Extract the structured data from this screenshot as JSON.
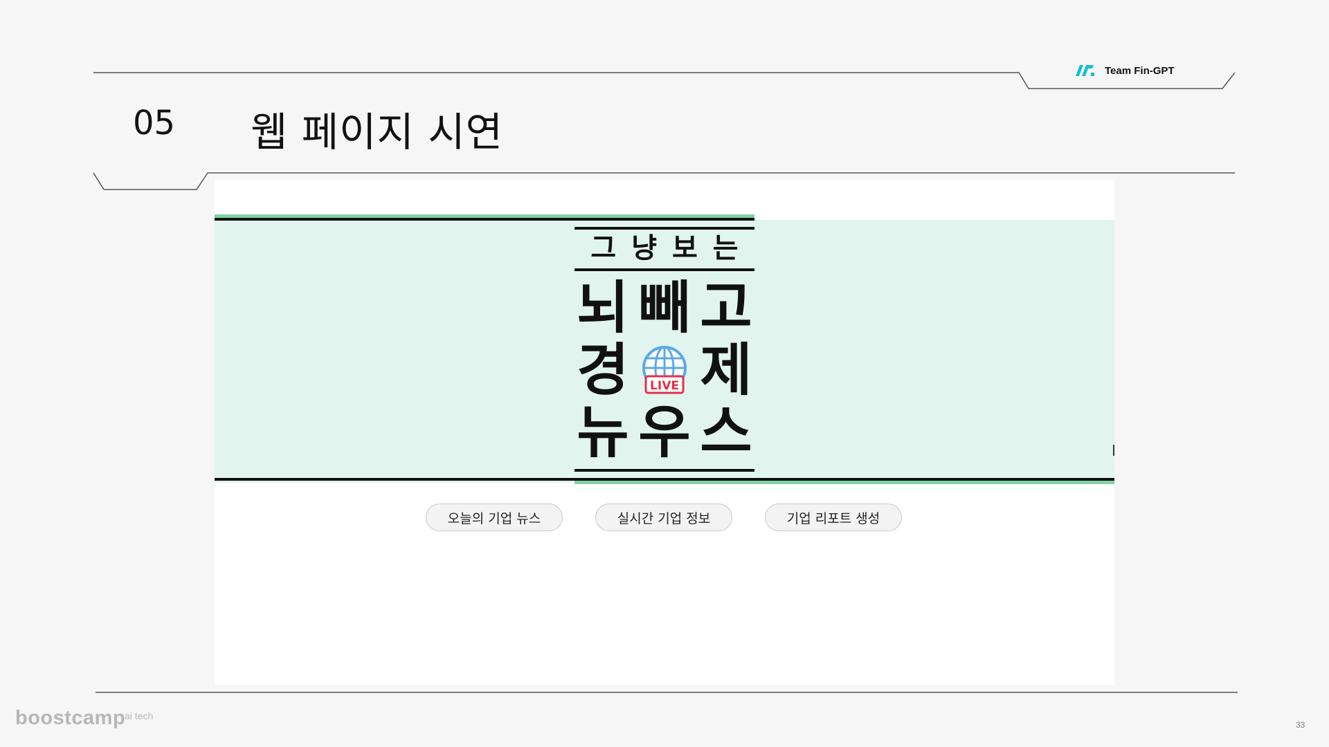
{
  "header": {
    "team_name": "Team Fin-GPT",
    "section_number": "05",
    "title": "웹 페이지 시연"
  },
  "screenshot": {
    "logo": {
      "subtitle": "그냥보는",
      "line1": [
        "뇌",
        "빼",
        "고"
      ],
      "line2": [
        "경",
        "제"
      ],
      "line3": [
        "뉴",
        "우",
        "스"
      ],
      "badge": "LIVE"
    },
    "nav_buttons": [
      {
        "label": "오늘의 기업 뉴스"
      },
      {
        "label": "실시간 기업 정보"
      },
      {
        "label": "기업 리포트 생성"
      }
    ]
  },
  "footer": {
    "brand": "boostcamp",
    "brand_sup": "ai tech",
    "page_number": "33"
  },
  "colors": {
    "background": "#f6f6f6",
    "mint_band": "#e1f5ee",
    "green_rule": "#7fd3a6",
    "logo_accent": "#14c0d6",
    "globe_blue": "#5aa9e6",
    "live_red": "#e0304a"
  }
}
